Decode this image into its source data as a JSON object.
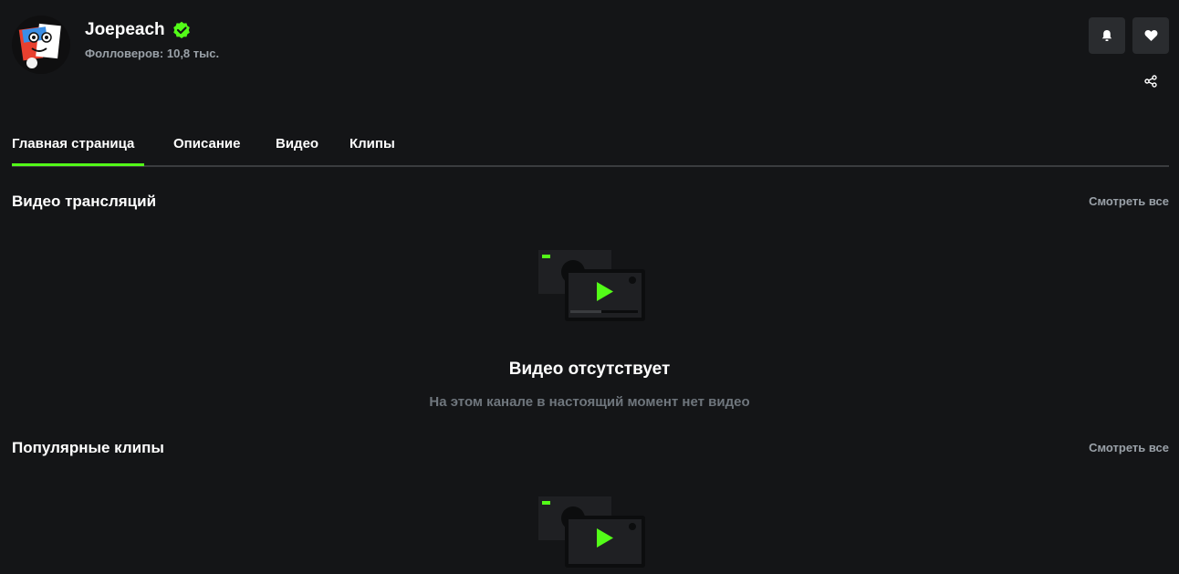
{
  "channel": {
    "name": "Joepeach",
    "followers": "Фолловеров: 10,8 тыс."
  },
  "actions": {
    "bell_icon": "bell-icon",
    "heart_icon": "heart-icon",
    "share_icon": "share-icon"
  },
  "tabs": [
    {
      "label": "Главная страница",
      "active": true
    },
    {
      "label": "Описание",
      "active": false
    },
    {
      "label": "Видео",
      "active": false
    },
    {
      "label": "Клипы",
      "active": false
    }
  ],
  "sections": [
    {
      "title": "Видео трансляций",
      "see_all": "Смотреть все",
      "empty_title": "Видео отсутствует",
      "empty_subtitle": "На этом канале в настоящий момент нет видео"
    },
    {
      "title": "Популярные клипы",
      "see_all": "Смотреть все"
    }
  ],
  "colors": {
    "background": "#141517",
    "accent": "#53fc18",
    "muted_text": "#9aa1a8",
    "button_bg": "#2a2c2f"
  }
}
